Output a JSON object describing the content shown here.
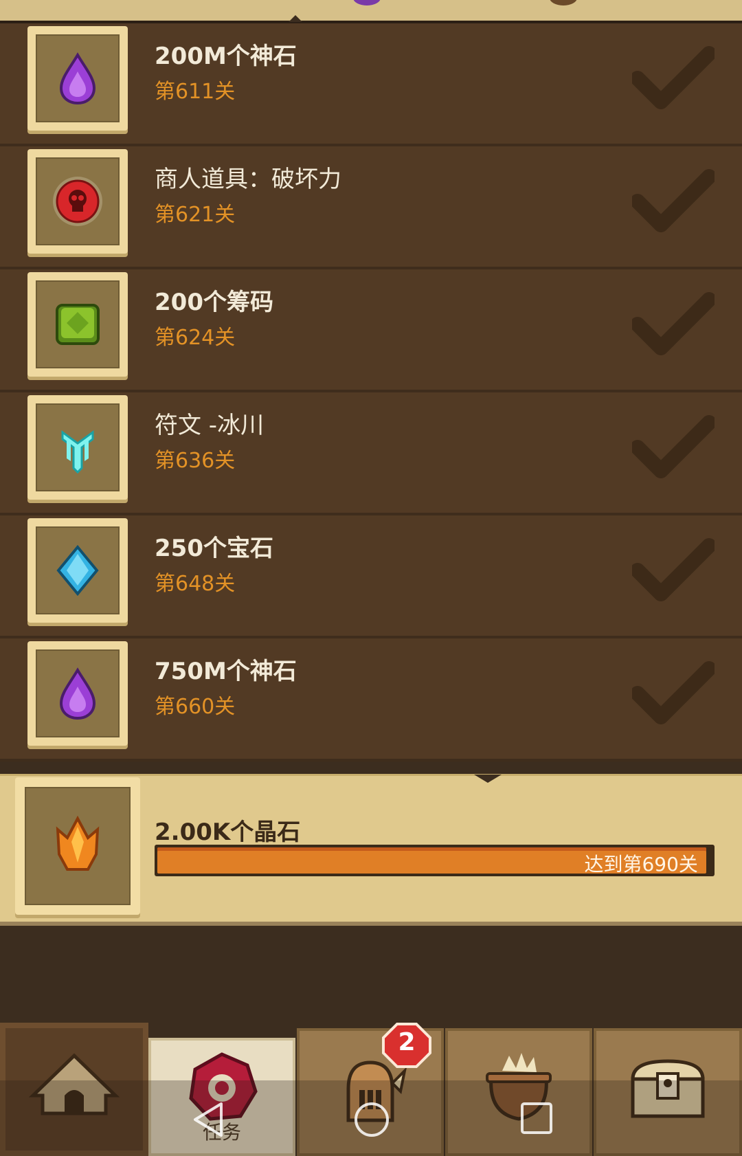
{
  "milestones": [
    {
      "title": "200M个神石",
      "level": "第611关",
      "icon": "purple-drop-icon"
    },
    {
      "title": "商人道具：破坏力",
      "level": "第621关",
      "icon": "red-skull-orb-icon"
    },
    {
      "title": "200个筹码",
      "level": "第624关",
      "icon": "green-chip-icon"
    },
    {
      "title": "符文 -冰川",
      "level": "第636关",
      "icon": "glacier-rune-icon"
    },
    {
      "title": "250个宝石",
      "level": "第648关",
      "icon": "blue-gem-icon"
    },
    {
      "title": "750M个神石",
      "level": "第660关",
      "icon": "purple-drop-icon"
    }
  ],
  "next_reward": {
    "title": "2.00K个晶石",
    "progress_label": "达到第690关",
    "progress": 0.99,
    "icon": "orange-crystal-icon"
  },
  "nav": {
    "home_icon": "camp-tent-icon",
    "tasks_label": "任务",
    "tasks_icon": "task-seal-icon",
    "hero_icon": "knight-helmet-icon",
    "hero_badge": "2",
    "pot_icon": "cauldron-icon",
    "chest_icon": "treasure-chest-icon"
  },
  "system_nav": {
    "back": "back-icon",
    "home": "home-circle-icon",
    "recents": "recents-square-icon"
  },
  "colors": {
    "title": "#f2ead8",
    "level": "#e39226",
    "progress": "#e07f26",
    "row": "#523a24"
  }
}
